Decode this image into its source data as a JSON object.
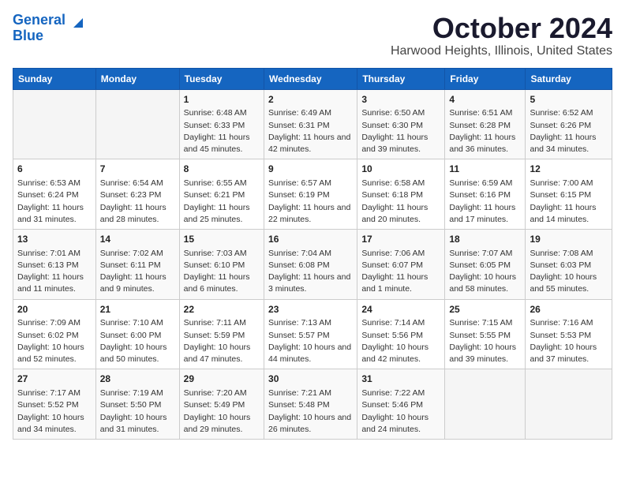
{
  "header": {
    "logo_line1": "General",
    "logo_line2": "Blue",
    "title": "October 2024",
    "subtitle": "Harwood Heights, Illinois, United States"
  },
  "days_of_week": [
    "Sunday",
    "Monday",
    "Tuesday",
    "Wednesday",
    "Thursday",
    "Friday",
    "Saturday"
  ],
  "weeks": [
    [
      {
        "day": null,
        "content": null
      },
      {
        "day": null,
        "content": null
      },
      {
        "day": "1",
        "content": "Sunrise: 6:48 AM\nSunset: 6:33 PM\nDaylight: 11 hours and 45 minutes."
      },
      {
        "day": "2",
        "content": "Sunrise: 6:49 AM\nSunset: 6:31 PM\nDaylight: 11 hours and 42 minutes."
      },
      {
        "day": "3",
        "content": "Sunrise: 6:50 AM\nSunset: 6:30 PM\nDaylight: 11 hours and 39 minutes."
      },
      {
        "day": "4",
        "content": "Sunrise: 6:51 AM\nSunset: 6:28 PM\nDaylight: 11 hours and 36 minutes."
      },
      {
        "day": "5",
        "content": "Sunrise: 6:52 AM\nSunset: 6:26 PM\nDaylight: 11 hours and 34 minutes."
      }
    ],
    [
      {
        "day": "6",
        "content": "Sunrise: 6:53 AM\nSunset: 6:24 PM\nDaylight: 11 hours and 31 minutes."
      },
      {
        "day": "7",
        "content": "Sunrise: 6:54 AM\nSunset: 6:23 PM\nDaylight: 11 hours and 28 minutes."
      },
      {
        "day": "8",
        "content": "Sunrise: 6:55 AM\nSunset: 6:21 PM\nDaylight: 11 hours and 25 minutes."
      },
      {
        "day": "9",
        "content": "Sunrise: 6:57 AM\nSunset: 6:19 PM\nDaylight: 11 hours and 22 minutes."
      },
      {
        "day": "10",
        "content": "Sunrise: 6:58 AM\nSunset: 6:18 PM\nDaylight: 11 hours and 20 minutes."
      },
      {
        "day": "11",
        "content": "Sunrise: 6:59 AM\nSunset: 6:16 PM\nDaylight: 11 hours and 17 minutes."
      },
      {
        "day": "12",
        "content": "Sunrise: 7:00 AM\nSunset: 6:15 PM\nDaylight: 11 hours and 14 minutes."
      }
    ],
    [
      {
        "day": "13",
        "content": "Sunrise: 7:01 AM\nSunset: 6:13 PM\nDaylight: 11 hours and 11 minutes."
      },
      {
        "day": "14",
        "content": "Sunrise: 7:02 AM\nSunset: 6:11 PM\nDaylight: 11 hours and 9 minutes."
      },
      {
        "day": "15",
        "content": "Sunrise: 7:03 AM\nSunset: 6:10 PM\nDaylight: 11 hours and 6 minutes."
      },
      {
        "day": "16",
        "content": "Sunrise: 7:04 AM\nSunset: 6:08 PM\nDaylight: 11 hours and 3 minutes."
      },
      {
        "day": "17",
        "content": "Sunrise: 7:06 AM\nSunset: 6:07 PM\nDaylight: 11 hours and 1 minute."
      },
      {
        "day": "18",
        "content": "Sunrise: 7:07 AM\nSunset: 6:05 PM\nDaylight: 10 hours and 58 minutes."
      },
      {
        "day": "19",
        "content": "Sunrise: 7:08 AM\nSunset: 6:03 PM\nDaylight: 10 hours and 55 minutes."
      }
    ],
    [
      {
        "day": "20",
        "content": "Sunrise: 7:09 AM\nSunset: 6:02 PM\nDaylight: 10 hours and 52 minutes."
      },
      {
        "day": "21",
        "content": "Sunrise: 7:10 AM\nSunset: 6:00 PM\nDaylight: 10 hours and 50 minutes."
      },
      {
        "day": "22",
        "content": "Sunrise: 7:11 AM\nSunset: 5:59 PM\nDaylight: 10 hours and 47 minutes."
      },
      {
        "day": "23",
        "content": "Sunrise: 7:13 AM\nSunset: 5:57 PM\nDaylight: 10 hours and 44 minutes."
      },
      {
        "day": "24",
        "content": "Sunrise: 7:14 AM\nSunset: 5:56 PM\nDaylight: 10 hours and 42 minutes."
      },
      {
        "day": "25",
        "content": "Sunrise: 7:15 AM\nSunset: 5:55 PM\nDaylight: 10 hours and 39 minutes."
      },
      {
        "day": "26",
        "content": "Sunrise: 7:16 AM\nSunset: 5:53 PM\nDaylight: 10 hours and 37 minutes."
      }
    ],
    [
      {
        "day": "27",
        "content": "Sunrise: 7:17 AM\nSunset: 5:52 PM\nDaylight: 10 hours and 34 minutes."
      },
      {
        "day": "28",
        "content": "Sunrise: 7:19 AM\nSunset: 5:50 PM\nDaylight: 10 hours and 31 minutes."
      },
      {
        "day": "29",
        "content": "Sunrise: 7:20 AM\nSunset: 5:49 PM\nDaylight: 10 hours and 29 minutes."
      },
      {
        "day": "30",
        "content": "Sunrise: 7:21 AM\nSunset: 5:48 PM\nDaylight: 10 hours and 26 minutes."
      },
      {
        "day": "31",
        "content": "Sunrise: 7:22 AM\nSunset: 5:46 PM\nDaylight: 10 hours and 24 minutes."
      },
      {
        "day": null,
        "content": null
      },
      {
        "day": null,
        "content": null
      }
    ]
  ]
}
